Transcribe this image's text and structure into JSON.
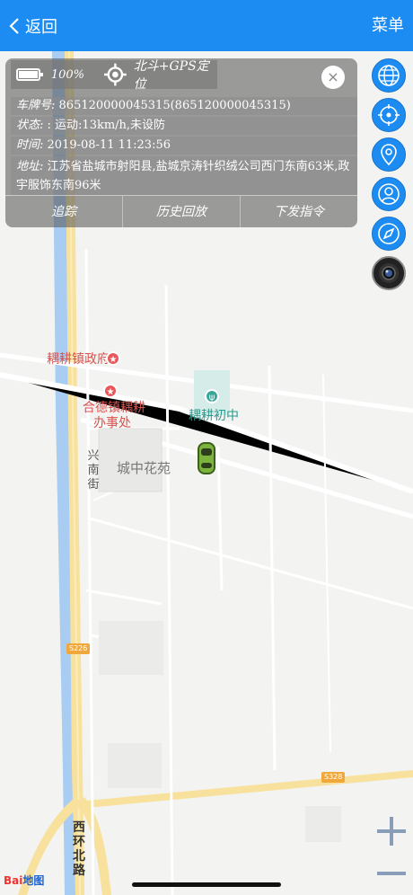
{
  "nav": {
    "back_label": "返回",
    "menu_label": "菜单"
  },
  "info_panel": {
    "battery_pct": "100%",
    "location_type": "北斗+GPS定位",
    "plate_key": "车牌号:",
    "plate_value": "865120000045315(865120000045315)",
    "status_key": "状态:",
    "status_value": ": 运动:13km/h,未设防",
    "time_key": "时间:",
    "time_value": "2019-08-11 11:23:56",
    "address_key": "地址:",
    "address_value": "江苏省盐城市射阳县,盐城京涛针织绒公司西门东南63米,政宇服饰东南96米",
    "actions": [
      "追踪",
      "历史回放",
      "下发指令"
    ]
  },
  "map": {
    "pois": {
      "gov": "耦耕镇政府",
      "office_line1": "合德镇耦耕",
      "office_line2": "办事处",
      "school": "耦耕初中",
      "garden": "城中花苑",
      "street": "兴南街",
      "road": "西环北路"
    },
    "shields": [
      "S226",
      "S328"
    ],
    "logo_text": "Bai",
    "logo_tail": "地图"
  },
  "colors": {
    "nav_bg": "#1c8cf2",
    "fab_bg": "#1c8cf2",
    "poi_red": "#d9534f",
    "poi_teal": "#2a9a8e"
  },
  "icons": {
    "fabs": [
      "globe-icon",
      "crosshair-icon",
      "location-pin-icon",
      "person-icon",
      "compass-icon",
      "camera-icon"
    ]
  }
}
